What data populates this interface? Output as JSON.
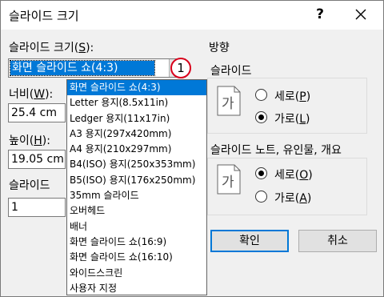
{
  "window": {
    "title": "슬라이드 크기",
    "help_label": "?"
  },
  "slide_size": {
    "label_text": "슬라이드 크기(",
    "label_key": "S",
    "label_suffix": "):",
    "selected": "화면 슬라이드 쇼(4:3)",
    "callout": "1",
    "options": [
      "화면 슬라이드 쇼(4:3)",
      "Letter 용지(8.5x11in)",
      "Ledger 용지(11x17in)",
      "A3 용지(297x420mm)",
      "A4 용지(210x297mm)",
      "B4(ISO) 용지(250x353mm)",
      "B5(ISO) 용지(176x250mm)",
      "35mm 슬라이드",
      "오버헤드",
      "배너",
      "화면 슬라이드 쇼(16:9)",
      "화면 슬라이드 쇼(16:10)",
      "와이드스크린",
      "사용자 지정"
    ]
  },
  "width": {
    "label_text": "너비(",
    "label_key": "W",
    "label_suffix": "):",
    "value": "25.4 cm"
  },
  "height": {
    "label_text": "높이(",
    "label_key": "H",
    "label_suffix": "):",
    "value": "19.05 cm"
  },
  "slide_number": {
    "label": "슬라이드",
    "value": "1"
  },
  "orientation": {
    "section_label": "방향",
    "slides": {
      "label": "슬라이드",
      "icon_glyph": "가",
      "portrait": {
        "text": "세로(",
        "key": "P",
        "suffix": ")"
      },
      "landscape": {
        "text": "가로(",
        "key": "L",
        "suffix": ")"
      },
      "selected": "landscape"
    },
    "notes": {
      "label": "슬라이드 노트, 유인물, 개요",
      "icon_glyph": "가",
      "portrait": {
        "text": "세로(",
        "key": "O",
        "suffix": ")"
      },
      "landscape": {
        "text": "가로(",
        "key": "A",
        "suffix": ")"
      },
      "selected": "portrait"
    }
  },
  "buttons": {
    "ok": "확인",
    "cancel": "취소"
  },
  "colors": {
    "selection": "#0078d7",
    "callout_ring": "#d9001b"
  }
}
